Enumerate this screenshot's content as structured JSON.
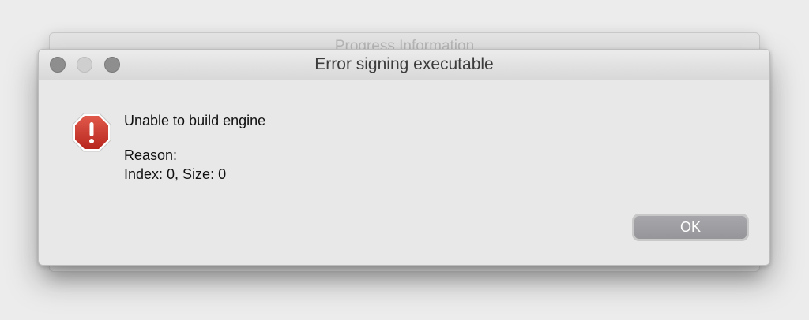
{
  "background_window": {
    "title": "Progress Information"
  },
  "dialog": {
    "title": "Error signing executable",
    "heading": "Unable to build engine",
    "reason_label": "Reason:",
    "reason_detail": "Index: 0, Size: 0",
    "ok_label": "OK",
    "icon": "error-octagon-icon"
  },
  "colors": {
    "error_red": "#cf3a2f",
    "button_gray": "#9e9ea2"
  }
}
